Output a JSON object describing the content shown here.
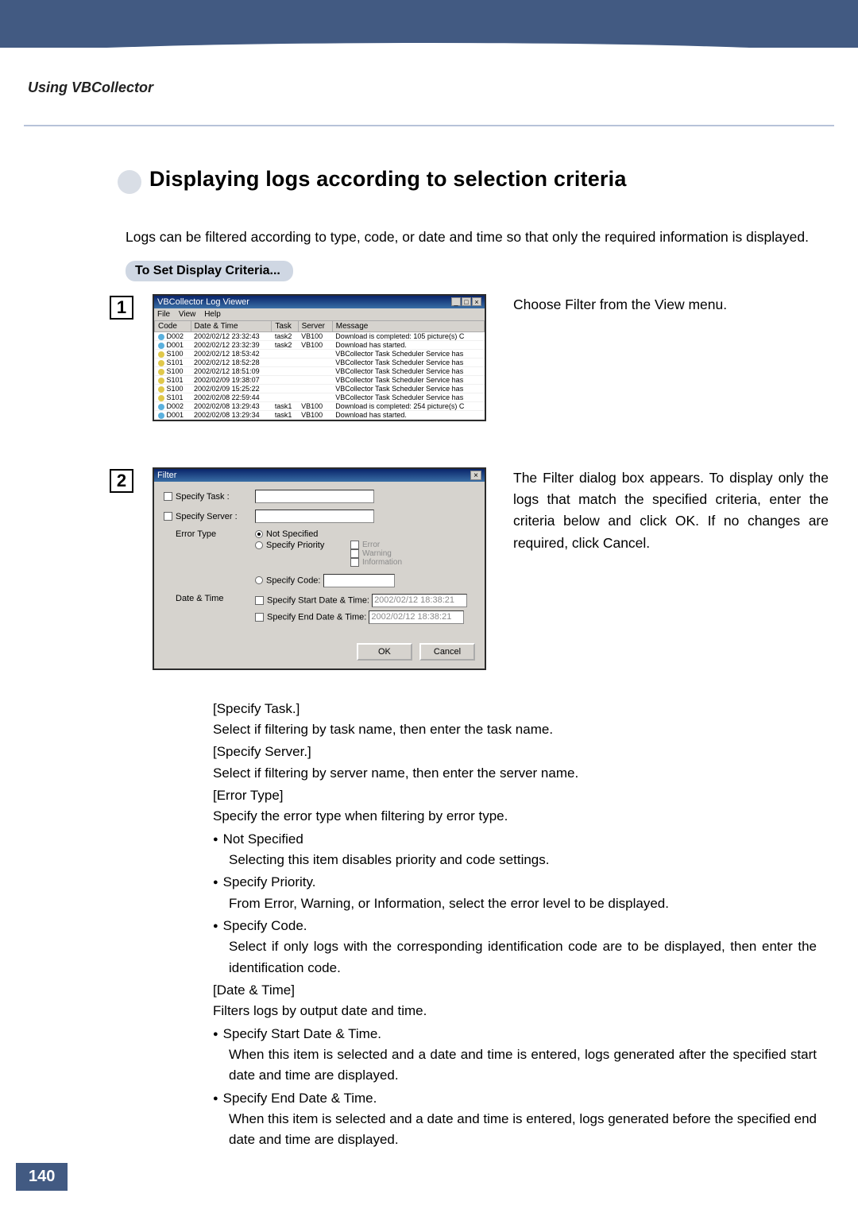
{
  "section_label": "Using VBCollector",
  "heading": "Displaying logs according to selection criteria",
  "intro": "Logs can be filtered according to type, code, or date and time so that only the required information is displayed.",
  "subhead": "To Set Display Criteria...",
  "page_number": "140",
  "step1": {
    "number": "1",
    "text": "Choose Filter from the View menu."
  },
  "step2": {
    "number": "2",
    "text": "The Filter dialog box appears. To display only the logs that match the specified criteria, enter the criteria below and click OK. If no changes are required, click Cancel."
  },
  "log_window": {
    "title": "VBCollector Log Viewer",
    "menus": {
      "file": "File",
      "view": "View",
      "help": "Help"
    },
    "headers": {
      "code": "Code",
      "date": "Date & Time",
      "task": "Task",
      "server": "Server",
      "message": "Message"
    },
    "rows": [
      {
        "code": "D002",
        "date": "2002/02/12 23:32:43",
        "task": "task2",
        "server": "VB100",
        "message": "Download is completed: 105 picture(s) C"
      },
      {
        "code": "D001",
        "date": "2002/02/12 23:32:39",
        "task": "task2",
        "server": "VB100",
        "message": "Download has started."
      },
      {
        "code": "S100",
        "date": "2002/02/12 18:53:42",
        "task": "",
        "server": "",
        "message": "VBCollector Task Scheduler Service has"
      },
      {
        "code": "S101",
        "date": "2002/02/12 18:52:28",
        "task": "",
        "server": "",
        "message": "VBCollector Task Scheduler Service has"
      },
      {
        "code": "S100",
        "date": "2002/02/12 18:51:09",
        "task": "",
        "server": "",
        "message": "VBCollector Task Scheduler Service has"
      },
      {
        "code": "S101",
        "date": "2002/02/09 19:38:07",
        "task": "",
        "server": "",
        "message": "VBCollector Task Scheduler Service has"
      },
      {
        "code": "S100",
        "date": "2002/02/09 15:25:22",
        "task": "",
        "server": "",
        "message": "VBCollector Task Scheduler Service has"
      },
      {
        "code": "S101",
        "date": "2002/02/08 22:59:44",
        "task": "",
        "server": "",
        "message": "VBCollector Task Scheduler Service has"
      },
      {
        "code": "D002",
        "date": "2002/02/08 13:29:43",
        "task": "task1",
        "server": "VB100",
        "message": "Download is completed: 254 picture(s) C"
      },
      {
        "code": "D001",
        "date": "2002/02/08 13:29:34",
        "task": "task1",
        "server": "VB100",
        "message": "Download has started."
      }
    ]
  },
  "filter_dialog": {
    "title": "Filter",
    "label_specify_task": "Specify Task :",
    "label_specify_server": "Specify Server :",
    "label_error_type": "Error Type",
    "opt_not_specified": "Not Specified",
    "opt_specify_priority": "Specify Priority",
    "opt_specify_code": "Specify Code:",
    "chk_error": "Error",
    "chk_warning": "Warning",
    "chk_information": "Information",
    "label_date_time": "Date & Time",
    "chk_start": "Specify Start Date & Time:",
    "chk_end": "Specify End Date & Time:",
    "date_value": "2002/02/12 18:38:21",
    "btn_ok": "OK",
    "btn_cancel": "Cancel"
  },
  "details": {
    "specify_task_h": "[Specify Task.]",
    "specify_task_d": "Select if filtering by task name, then enter the task name.",
    "specify_server_h": "[Specify Server.]",
    "specify_server_d": "Select if filtering by server name, then enter the server name.",
    "error_type_h": "[Error Type]",
    "error_type_d": "Specify the error type when filtering by error type.",
    "not_specified_b": "Not Specified",
    "not_specified_d": "Selecting this item disables priority and code settings.",
    "specify_priority_b": "Specify Priority.",
    "specify_priority_d": "From Error, Warning, or Information, select the error level to be displayed.",
    "specify_code_b": "Specify Code.",
    "specify_code_d": "Select if only logs with the corresponding identification code are to be displayed, then enter the identification code.",
    "date_time_h": "[Date & Time]",
    "date_time_d": "Filters logs by output date and time.",
    "start_b": "Specify Start Date & Time.",
    "start_d": "When this item is selected and a date and time is entered, logs generated after the specified start date and time are displayed.",
    "end_b": "Specify End Date & Time.",
    "end_d": "When this item is selected and a date and time is entered, logs generated before the specified end date and time are displayed."
  }
}
